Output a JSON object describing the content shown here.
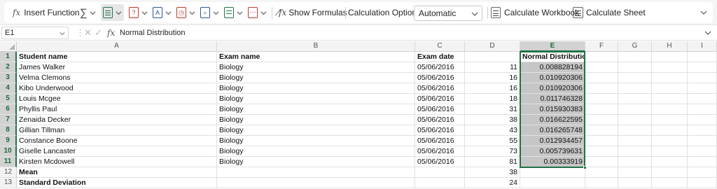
{
  "ribbon": {
    "insert_function": "Insert Function",
    "show_formulas": "Show Formulas",
    "calc_options_label": "Calculation Options",
    "calc_options_value": "Automatic",
    "calculate_workbook": "Calculate Workbook",
    "calculate_sheet": "Calculate Sheet",
    "accent_color": "#217346"
  },
  "formula_bar": {
    "name_box": "E1",
    "fx_label": "fx",
    "formula": "Normal Distribution"
  },
  "columns": [
    "A",
    "B",
    "C",
    "D",
    "E",
    "F",
    "G",
    "H",
    "I"
  ],
  "rows": [
    {
      "num": "1",
      "a": "Student name",
      "b": "Exam name",
      "c": "Exam date",
      "d": "",
      "e": "Normal Distribution"
    },
    {
      "num": "2",
      "a": "James Walker",
      "b": "Biology",
      "c": "05/06/2016",
      "d": "11",
      "e": "0.008828194"
    },
    {
      "num": "3",
      "a": "Velma Clemons",
      "b": "Biology",
      "c": "05/06/2016",
      "d": "16",
      "e": "0.010920306"
    },
    {
      "num": "4",
      "a": "Kibo Underwood",
      "b": "Biology",
      "c": "05/06/2016",
      "d": "16",
      "e": "0.010920306"
    },
    {
      "num": "5",
      "a": "Louis Mcgee",
      "b": "Biology",
      "c": "05/06/2016",
      "d": "18",
      "e": "0.011746328"
    },
    {
      "num": "6",
      "a": "Phyllis Paul",
      "b": "Biology",
      "c": "05/06/2016",
      "d": "31",
      "e": "0.015930383"
    },
    {
      "num": "7",
      "a": "Zenaida Decker",
      "b": "Biology",
      "c": "05/06/2016",
      "d": "38",
      "e": "0.016622595"
    },
    {
      "num": "8",
      "a": "Gillian Tillman",
      "b": "Biology",
      "c": "05/06/2016",
      "d": "43",
      "e": "0.016265748"
    },
    {
      "num": "9",
      "a": "Constance Boone",
      "b": "Biology",
      "c": "05/06/2016",
      "d": "55",
      "e": "0.012934457"
    },
    {
      "num": "10",
      "a": "Giselle Lancaster",
      "b": "Biology",
      "c": "05/06/2016",
      "d": "73",
      "e": "0.005739631"
    },
    {
      "num": "11",
      "a": "Kirsten Mcdowell",
      "b": "Biology",
      "c": "05/06/2016",
      "d": "81",
      "e": "0.00333919"
    },
    {
      "num": "12",
      "a": "Mean",
      "b": "",
      "c": "",
      "d": "38",
      "e": ""
    },
    {
      "num": "13",
      "a": "Standard Deviation",
      "b": "",
      "c": "",
      "d": "24",
      "e": ""
    }
  ]
}
